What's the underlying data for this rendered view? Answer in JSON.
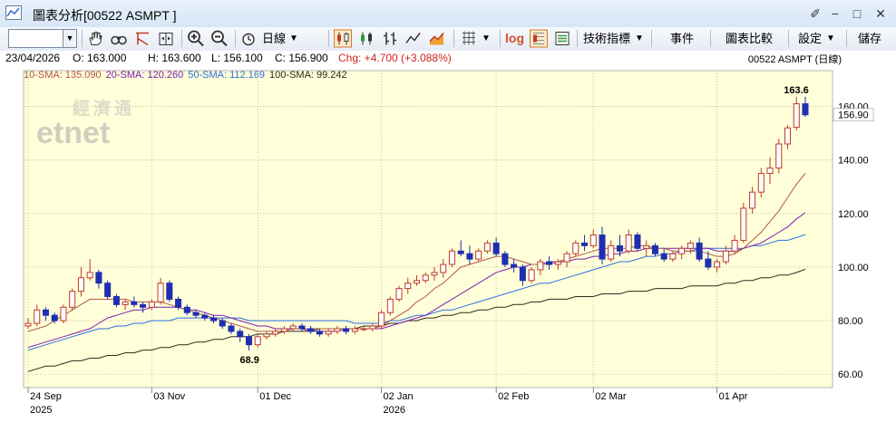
{
  "window": {
    "title": "圖表分析[00522 ASMPT ]",
    "controls": [
      "✐",
      "−",
      "□",
      "✕"
    ]
  },
  "toolbar": {
    "period_label": "日線",
    "indicators_label": "技術指標",
    "events_label": "事件",
    "compare_label": "圖表比較",
    "settings_label": "設定",
    "save_label": "儲存",
    "log_label": "log",
    "icons": [
      "hand-icon",
      "binoculars-icon",
      "crosshair-icon",
      "scroll-icon",
      "zoom-in-icon",
      "zoom-out-icon",
      "clock-icon",
      "candlestick-icon",
      "candlestick-alt-icon",
      "ohlc-icon",
      "line-icon",
      "area-icon",
      "grid-icon",
      "percent-icon",
      "export-icon"
    ]
  },
  "info": {
    "date": "23/04/2026",
    "open": "O: 163.000",
    "high": "H: 163.600",
    "low": "L: 156.100",
    "close": "C: 156.900",
    "change": "Chg: +4.700 (+3.088%)",
    "symbol": "00522   ASMPT (日線)"
  },
  "legend": {
    "sma10": "10-SMA: 135.090",
    "sma20": "20-SMA: 120.260",
    "sma50": "50-SMA: 112.169",
    "sma100": "100-SMA: 99.242"
  },
  "watermark": {
    "cn": "經濟通",
    "en": "etnet"
  },
  "colors": {
    "chart_bg": "#ffffd9",
    "up": "#c0392b",
    "down": "#1f2fb0",
    "sma10": "#b1584a",
    "sma20": "#7a1fb8",
    "sma50": "#2b6fe0",
    "sma100": "#2c2c1c"
  },
  "chart_data": {
    "type": "candlestick",
    "ylim": [
      55,
      170
    ],
    "yticks": [
      60,
      80,
      100,
      120,
      140,
      160
    ],
    "ytick_labels": [
      "60.00",
      "80.00",
      "100.00",
      "120.00",
      "140.00",
      "160.00"
    ],
    "last_price_label": "156.90",
    "last_price": 156.9,
    "high_annotation": {
      "index": 87,
      "value": 163.6,
      "label": "163.6"
    },
    "low_annotation": {
      "index": 25,
      "value": 68.9,
      "label": "68.9"
    },
    "xticks": [
      {
        "index": 0,
        "label": "24 Sep",
        "year": "2025"
      },
      {
        "index": 14,
        "label": "03 Nov",
        "year": ""
      },
      {
        "index": 26,
        "label": "01 Dec",
        "year": ""
      },
      {
        "index": 40,
        "label": "02 Jan",
        "year": "2026"
      },
      {
        "index": 53,
        "label": "02 Feb",
        "year": ""
      },
      {
        "index": 64,
        "label": "02 Mar",
        "year": ""
      },
      {
        "index": 78,
        "label": "01 Apr",
        "year": ""
      }
    ],
    "candles": [
      [
        78,
        81,
        77,
        79
      ],
      [
        79,
        86,
        78,
        84
      ],
      [
        84,
        85,
        80,
        82
      ],
      [
        82,
        83,
        79,
        80
      ],
      [
        80,
        86,
        79,
        85
      ],
      [
        85,
        92,
        84,
        91
      ],
      [
        91,
        100,
        89,
        96
      ],
      [
        96,
        103,
        95,
        98
      ],
      [
        98,
        99,
        92,
        94
      ],
      [
        94,
        95,
        88,
        89
      ],
      [
        89,
        90,
        85,
        86
      ],
      [
        86,
        88,
        84,
        87
      ],
      [
        87,
        89,
        85,
        86
      ],
      [
        86,
        87,
        83,
        85
      ],
      [
        85,
        88,
        84,
        87
      ],
      [
        87,
        96,
        86,
        94
      ],
      [
        94,
        95,
        87,
        88
      ],
      [
        88,
        89,
        84,
        85
      ],
      [
        85,
        86,
        82,
        83
      ],
      [
        83,
        84,
        81,
        82
      ],
      [
        82,
        83,
        80,
        81
      ],
      [
        81,
        82,
        79,
        80
      ],
      [
        80,
        81,
        77,
        78
      ],
      [
        78,
        79,
        75,
        76
      ],
      [
        76,
        77,
        72,
        74
      ],
      [
        74,
        75,
        68.9,
        71
      ],
      [
        71,
        75,
        70,
        74
      ],
      [
        74,
        76,
        73,
        75
      ],
      [
        75,
        77,
        74,
        76
      ],
      [
        76,
        78,
        75,
        77
      ],
      [
        77,
        79,
        76,
        78
      ],
      [
        78,
        79,
        76,
        77
      ],
      [
        77,
        78,
        75,
        76
      ],
      [
        76,
        77,
        74,
        75
      ],
      [
        75,
        77,
        74,
        76
      ],
      [
        76,
        78,
        75,
        77
      ],
      [
        77,
        78,
        75,
        76
      ],
      [
        76,
        78,
        75,
        77
      ],
      [
        77,
        78,
        76,
        77
      ],
      [
        77,
        79,
        76,
        78
      ],
      [
        78,
        84,
        77,
        83
      ],
      [
        83,
        89,
        82,
        88
      ],
      [
        88,
        93,
        87,
        92
      ],
      [
        92,
        96,
        90,
        94
      ],
      [
        94,
        97,
        93,
        95
      ],
      [
        95,
        98,
        94,
        97
      ],
      [
        97,
        100,
        95,
        98
      ],
      [
        98,
        103,
        96,
        101
      ],
      [
        101,
        107,
        100,
        106
      ],
      [
        106,
        110,
        104,
        105
      ],
      [
        105,
        108,
        101,
        103
      ],
      [
        103,
        107,
        102,
        106
      ],
      [
        106,
        110,
        105,
        109
      ],
      [
        109,
        111,
        104,
        105
      ],
      [
        105,
        106,
        100,
        101
      ],
      [
        101,
        103,
        98,
        100
      ],
      [
        100,
        101,
        93,
        95
      ],
      [
        95,
        100,
        94,
        99
      ],
      [
        99,
        103,
        97,
        102
      ],
      [
        102,
        104,
        99,
        101
      ],
      [
        101,
        103,
        99,
        102
      ],
      [
        102,
        106,
        100,
        105
      ],
      [
        105,
        110,
        104,
        109
      ],
      [
        109,
        112,
        106,
        108
      ],
      [
        108,
        114,
        107,
        112
      ],
      [
        112,
        115,
        101,
        103
      ],
      [
        103,
        110,
        102,
        108
      ],
      [
        108,
        112,
        104,
        106
      ],
      [
        106,
        114,
        105,
        112
      ],
      [
        112,
        113,
        106,
        107
      ],
      [
        107,
        110,
        104,
        108
      ],
      [
        108,
        109,
        104,
        105
      ],
      [
        105,
        107,
        102,
        103
      ],
      [
        103,
        106,
        102,
        105
      ],
      [
        105,
        108,
        103,
        107
      ],
      [
        107,
        110,
        105,
        109
      ],
      [
        109,
        111,
        102,
        103
      ],
      [
        103,
        106,
        99,
        100
      ],
      [
        100,
        103,
        98,
        102
      ],
      [
        102,
        108,
        101,
        106
      ],
      [
        106,
        112,
        105,
        110
      ],
      [
        110,
        124,
        109,
        122
      ],
      [
        122,
        130,
        120,
        128
      ],
      [
        128,
        137,
        126,
        135
      ],
      [
        135,
        141,
        131,
        137
      ],
      [
        137,
        148,
        135,
        146
      ],
      [
        146,
        153,
        144,
        152
      ],
      [
        152.2,
        163.6,
        151,
        161
      ],
      [
        161,
        163.6,
        156.1,
        156.9
      ]
    ],
    "sma10": [
      76,
      77,
      78,
      80,
      82,
      84,
      86,
      88,
      88,
      88,
      88,
      88,
      87,
      87,
      87,
      87,
      86,
      85,
      84,
      83,
      82,
      81,
      80,
      79,
      78,
      77,
      76,
      76,
      76,
      76,
      77,
      77,
      77,
      77,
      77,
      77,
      77,
      77,
      77,
      77,
      78,
      80,
      82,
      84,
      87,
      89,
      92,
      94,
      97,
      100,
      101,
      102,
      103,
      104,
      104,
      103,
      102,
      101,
      101,
      101,
      102,
      103,
      104,
      105,
      106,
      107,
      107,
      107,
      107,
      108,
      108,
      107,
      107,
      106,
      106,
      106,
      106,
      105,
      104,
      104,
      105,
      107,
      110,
      113,
      117,
      121,
      126,
      131,
      135
    ],
    "sma20": [
      70,
      71,
      72,
      73,
      74,
      75,
      76,
      77,
      79,
      81,
      82,
      83,
      84,
      84,
      85,
      85,
      85,
      85,
      84,
      84,
      83,
      82,
      82,
      81,
      80,
      79,
      78,
      78,
      77,
      77,
      77,
      77,
      76,
      76,
      76,
      76,
      77,
      77,
      77,
      77,
      77,
      78,
      79,
      80,
      81,
      82,
      84,
      86,
      88,
      90,
      92,
      94,
      96,
      98,
      99,
      100,
      100,
      101,
      101,
      102,
      102,
      102,
      103,
      103,
      104,
      104,
      105,
      105,
      106,
      106,
      107,
      107,
      107,
      107,
      107,
      107,
      107,
      107,
      106,
      106,
      106,
      107,
      108,
      109,
      111,
      113,
      115,
      118,
      120.3
    ],
    "sma50": [
      69,
      70,
      71,
      72,
      73,
      74,
      75,
      76,
      77,
      77,
      78,
      78,
      79,
      79,
      80,
      80,
      80,
      81,
      81,
      81,
      81,
      81,
      81,
      81,
      81,
      80,
      80,
      80,
      80,
      80,
      80,
      80,
      80,
      80,
      80,
      80,
      80,
      79,
      79,
      79,
      79,
      80,
      80,
      81,
      82,
      82,
      83,
      84,
      84,
      85,
      86,
      87,
      88,
      89,
      90,
      91,
      92,
      93,
      94,
      94,
      95,
      96,
      97,
      98,
      99,
      100,
      101,
      102,
      102,
      103,
      104,
      104,
      105,
      105,
      106,
      106,
      107,
      107,
      107,
      107,
      107,
      107,
      108,
      108,
      109,
      110,
      110,
      111,
      112.2
    ],
    "sma100": [
      61,
      62,
      63,
      63,
      64,
      65,
      65,
      66,
      66,
      67,
      67,
      68,
      68,
      69,
      69,
      70,
      70,
      71,
      71,
      72,
      72,
      73,
      73,
      74,
      74,
      74,
      75,
      75,
      75,
      76,
      76,
      76,
      76,
      77,
      77,
      77,
      77,
      77,
      78,
      78,
      78,
      79,
      79,
      80,
      80,
      81,
      81,
      82,
      82,
      83,
      83,
      84,
      84,
      85,
      85,
      86,
      86,
      87,
      87,
      88,
      88,
      88,
      89,
      89,
      89,
      90,
      90,
      90,
      91,
      91,
      91,
      92,
      92,
      92,
      92,
      93,
      93,
      93,
      93,
      94,
      94,
      95,
      95,
      96,
      96,
      97,
      97,
      98,
      99.2
    ]
  }
}
